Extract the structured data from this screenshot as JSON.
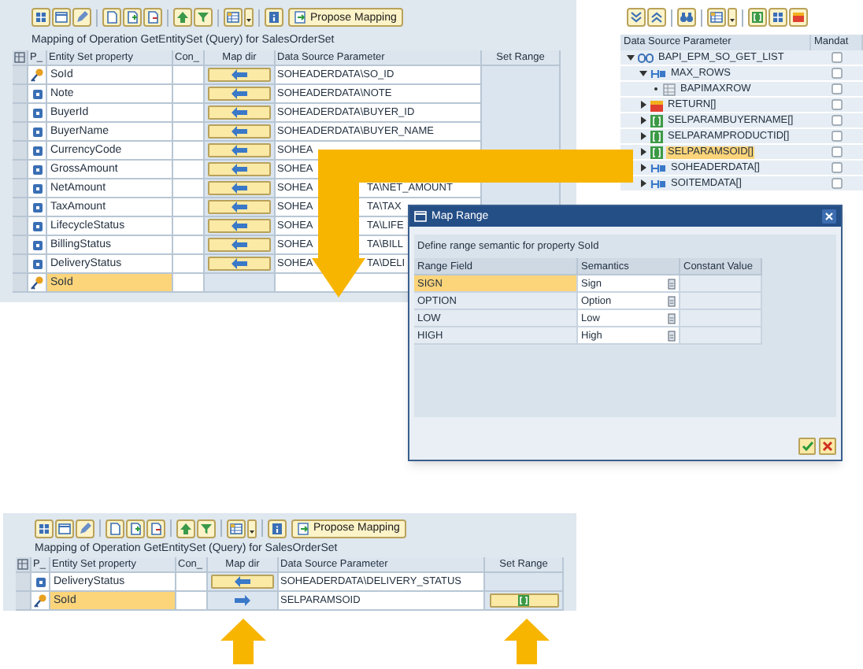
{
  "mapping": {
    "propose_button": "Propose Mapping",
    "title": "Mapping of Operation GetEntitySet (Query) for SalesOrderSet",
    "columns": [
      "P_",
      "Entity Set property",
      "Con_",
      "Map dir",
      "Data Source Parameter",
      "Set Range"
    ],
    "rows": [
      {
        "kind": "key",
        "property": "SoId",
        "map_dir": {
          "kind": "left"
        },
        "data_source": "SOHEADERDATA\\SO_ID",
        "selected": false
      },
      {
        "kind": "property",
        "property": "Note",
        "map_dir": {
          "kind": "left"
        },
        "data_source": "SOHEADERDATA\\NOTE",
        "selected": false
      },
      {
        "kind": "property",
        "property": "BuyerId",
        "map_dir": {
          "kind": "left"
        },
        "data_source": "SOHEADERDATA\\BUYER_ID",
        "selected": false
      },
      {
        "kind": "property",
        "property": "BuyerName",
        "map_dir": {
          "kind": "left"
        },
        "data_source": "SOHEADERDATA\\BUYER_NAME",
        "selected": false
      },
      {
        "kind": "property",
        "property": "CurrencyCode",
        "map_dir": {
          "kind": "left"
        },
        "data_source": "SOHEA",
        "selected": false
      },
      {
        "kind": "property",
        "property": "GrossAmount",
        "map_dir": {
          "kind": "left"
        },
        "data_source": "SOHEA",
        "selected": false
      },
      {
        "kind": "property",
        "property": "NetAmount",
        "map_dir": {
          "kind": "left"
        },
        "data_source": "SOHEA",
        "data_source_tail": "TA\\NET_AMOUNT",
        "selected": false
      },
      {
        "kind": "property",
        "property": "TaxAmount",
        "map_dir": {
          "kind": "left"
        },
        "data_source": "SOHEA",
        "data_source_tail": "TA\\TAX",
        "selected": false
      },
      {
        "kind": "property",
        "property": "LifecycleStatus",
        "map_dir": {
          "kind": "left"
        },
        "data_source": "SOHEA",
        "data_source_tail": "TA\\LIFE",
        "selected": false
      },
      {
        "kind": "property",
        "property": "BillingStatus",
        "map_dir": {
          "kind": "left"
        },
        "data_source": "SOHEA",
        "data_source_tail": "TA\\BILL",
        "selected": false
      },
      {
        "kind": "property",
        "property": "DeliveryStatus",
        "map_dir": {
          "kind": "left"
        },
        "data_source": "SOHEA",
        "data_source_tail": "TA\\DELI",
        "selected": false
      },
      {
        "kind": "key",
        "property": "SoId",
        "selected": true
      }
    ]
  },
  "data_source": {
    "columns": [
      "Data Source Parameter",
      "Mandat"
    ],
    "tree": [
      {
        "label": "BAPI_EPM_SO_GET_LIST",
        "kind": "function",
        "expanded": true,
        "selected": false,
        "mandatory": false,
        "children": [
          {
            "label": "MAX_ROWS",
            "kind": "structure",
            "expanded": true,
            "selected": false,
            "mandatory": false,
            "children": [
              {
                "label": "BAPIMAXROW",
                "kind": "field",
                "selected": false,
                "mandatory": false
              }
            ]
          },
          {
            "label": "RETURN[]",
            "kind": "return",
            "expanded": false,
            "selected": false,
            "mandatory": false
          },
          {
            "label": "SELPARAMBUYERNAME[]",
            "kind": "range",
            "expanded": false,
            "selected": false,
            "mandatory": false
          },
          {
            "label": "SELPARAMPRODUCTID[]",
            "kind": "range",
            "expanded": false,
            "selected": false,
            "mandatory": false
          },
          {
            "label": "SELPARAMSOID[]",
            "kind": "range",
            "expanded": false,
            "selected": true,
            "mandatory": false
          },
          {
            "label": "SOHEADERDATA[]",
            "kind": "structure",
            "expanded": false,
            "selected": false,
            "mandatory": false
          },
          {
            "label": "SOITEMDATA[]",
            "kind": "structure",
            "expanded": false,
            "selected": false,
            "mandatory": false
          }
        ]
      }
    ]
  },
  "dialog": {
    "title": "Map Range",
    "description": "Define range semantic for property SoId",
    "columns": [
      "Range Field",
      "Semantics",
      "Constant Value"
    ],
    "rows": [
      {
        "field": "SIGN",
        "semantics": "Sign",
        "selected": true
      },
      {
        "field": "OPTION",
        "semantics": "Option",
        "selected": false
      },
      {
        "field": "LOW",
        "semantics": "Low",
        "selected": false
      },
      {
        "field": "HIGH",
        "semantics": "High",
        "selected": false
      }
    ]
  },
  "result": {
    "propose_button": "Propose Mapping",
    "title": "Mapping of Operation GetEntitySet (Query) for SalesOrderSet",
    "columns": [
      "P_",
      "Entity Set property",
      "Con_",
      "Map dir",
      "Data Source Parameter",
      "Set Range"
    ],
    "rows": [
      {
        "kind": "property",
        "property": "DeliveryStatus",
        "map_dir": {
          "kind": "left"
        },
        "data_source": "SOHEADERDATA\\DELIVERY_STATUS",
        "set_range": false,
        "selected": false
      },
      {
        "kind": "key",
        "property": "SoId",
        "map_dir": {
          "kind": "right"
        },
        "data_source": "SELPARAMSOID",
        "set_range": true,
        "selected": true
      }
    ]
  }
}
